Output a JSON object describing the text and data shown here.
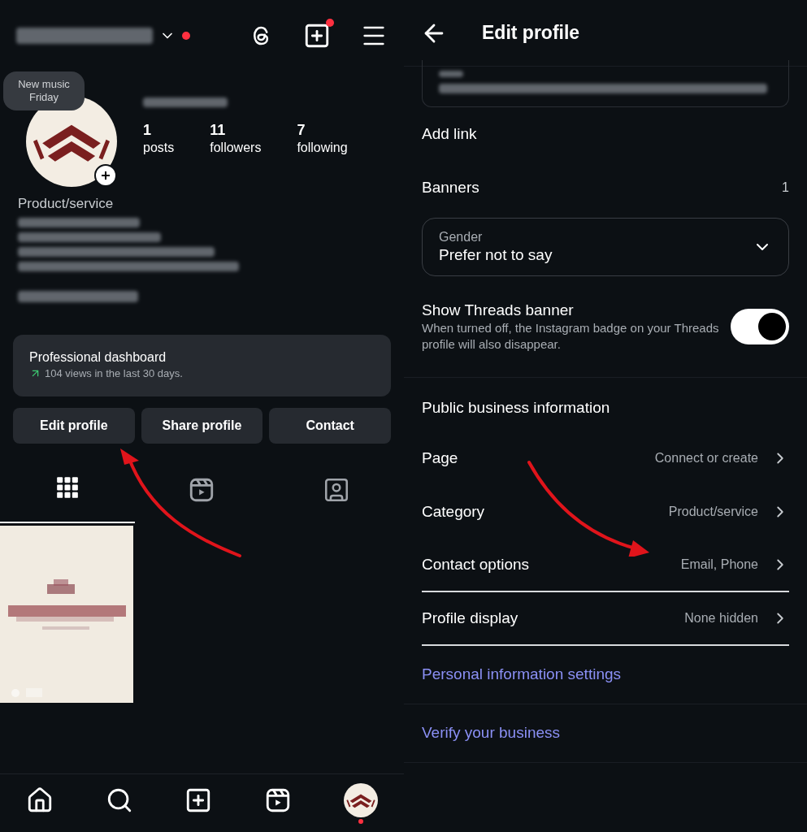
{
  "profile_screen": {
    "header": {
      "account_notification": true,
      "create_notification": true
    },
    "story_bubble": "New music Friday",
    "stats": [
      {
        "value": "1",
        "label": "posts"
      },
      {
        "value": "11",
        "label": "followers"
      },
      {
        "value": "7",
        "label": "following"
      }
    ],
    "category": "Product/service",
    "dashboard": {
      "title": "Professional dashboard",
      "subtitle": "104 views in the last 30 days."
    },
    "buttons": [
      "Edit profile",
      "Share profile",
      "Contact"
    ],
    "content_tabs": [
      {
        "kind": "grid",
        "selected": true
      },
      {
        "kind": "reels",
        "selected": false
      },
      {
        "kind": "tagged",
        "selected": false
      }
    ],
    "posts": [
      {
        "kind": "picture"
      }
    ],
    "bottom_nav": [
      {
        "kind": "home",
        "notification": false
      },
      {
        "kind": "search",
        "notification": false
      },
      {
        "kind": "create",
        "notification": false
      },
      {
        "kind": "reels",
        "notification": false
      },
      {
        "kind": "profile",
        "notification": true
      }
    ]
  },
  "edit_profile_screen": {
    "title": "Edit profile",
    "rows": [
      {
        "label": "Add link"
      },
      {
        "label": "Banners",
        "value": "1"
      }
    ],
    "gender": {
      "label": "Gender",
      "value": "Prefer not to say"
    },
    "threads_banner": {
      "title": "Show Threads banner",
      "description": "When turned off, the Instagram badge on your Threads profile will also disappear.",
      "on": true
    },
    "section_title": "Public business information",
    "business_rows": [
      {
        "label": "Page",
        "value": "Connect or create",
        "divider_below": false
      },
      {
        "label": "Category",
        "value": "Product/service",
        "divider_below": false
      },
      {
        "label": "Contact options",
        "value": "Email, Phone",
        "divider_below": true
      },
      {
        "label": "Profile display",
        "value": "None hidden",
        "divider_below": true
      }
    ],
    "links": [
      {
        "label": "Personal information settings"
      },
      {
        "label": "Verify your business"
      }
    ]
  }
}
